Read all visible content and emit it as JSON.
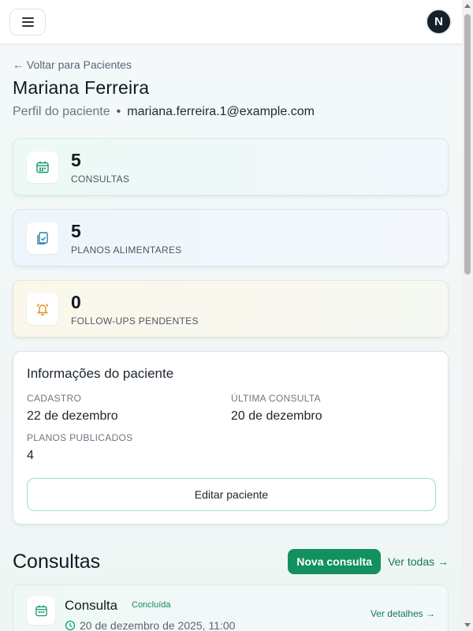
{
  "header": {
    "menu_icon": "hamburger-menu-icon",
    "avatar_initial": "N"
  },
  "back_link": "← Voltar para Pacientes",
  "patient": {
    "name": "Mariana Ferreira",
    "profile_label": "Perfil do paciente",
    "separator": "•",
    "email": "mariana.ferreira.1@example.com"
  },
  "stats": [
    {
      "value": "5",
      "label": "CONSULTAS",
      "icon": "calendar-icon",
      "color": "#1a9b6c"
    },
    {
      "value": "5",
      "label": "PLANOS ALIMENTARES",
      "icon": "clipboard-check-icon",
      "color": "#2a7fa8"
    },
    {
      "value": "0",
      "label": "FOLLOW-UPS PENDENTES",
      "icon": "bell-icon",
      "color": "#e0901a"
    }
  ],
  "info": {
    "title": "Informações do paciente",
    "items": [
      {
        "key": "CADASTRO",
        "value": "22 de dezembro"
      },
      {
        "key": "ÚLTIMA CONSULTA",
        "value": "20 de dezembro"
      },
      {
        "key": "PLANOS PUBLICADOS",
        "value": "4"
      }
    ],
    "edit_label": "Editar paciente"
  },
  "consultations": {
    "title": "Consultas",
    "new_label": "Nova consulta",
    "see_all_label": "Ver todas →",
    "items": [
      {
        "title": "Consulta",
        "status": "Concluída",
        "date": "20 de dezembro de 2025, 11:00",
        "details_label": "Ver detalhes →"
      }
    ]
  },
  "colors": {
    "accent": "#12915f",
    "text_dark": "#111a22"
  }
}
